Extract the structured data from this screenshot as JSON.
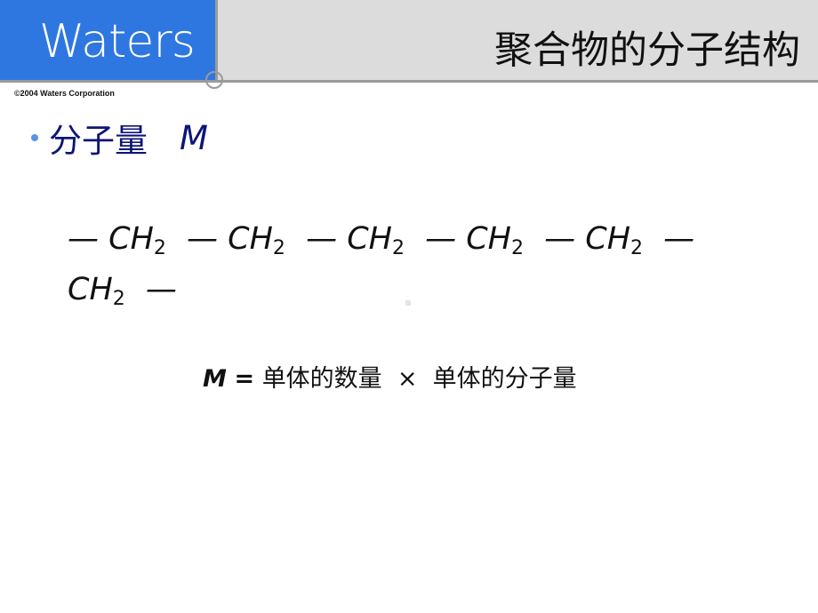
{
  "header": {
    "logo": "Waters",
    "title": "聚合物的分子结构",
    "copyright": "©2004 Waters Corporation"
  },
  "bullet": {
    "text": "分子量",
    "symbol": "M"
  },
  "chain": {
    "units": [
      "— CH",
      "— CH",
      "— CH",
      "— CH",
      "— CH",
      "— CH"
    ],
    "subscript": "2",
    "tail": "—"
  },
  "formula": {
    "lhs": "M",
    "equals": "=",
    "term1": "单体的数量",
    "times": "×",
    "term2": "单体的分子量"
  }
}
